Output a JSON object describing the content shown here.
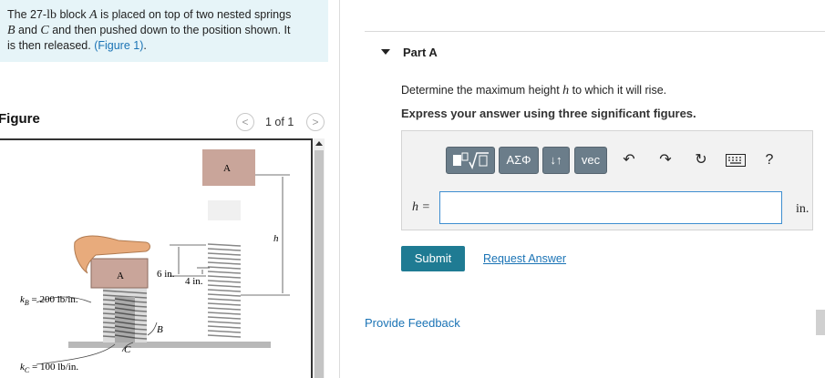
{
  "problem": {
    "line1_pre": "The 27-",
    "line1_unit": "lb",
    "line1_mid": " block ",
    "line1_A": "A",
    "line1_post": " is placed on top of two nested springs",
    "line2_B": "B",
    "line2_mid": " and ",
    "line2_C": "C",
    "line2_post": " and then pushed down to the position shown. It",
    "line3_pre": "is then released. ",
    "figure_link": "(Figure 1)",
    "line3_post": "."
  },
  "figure": {
    "title": "Figure",
    "pager_text": "1 of 1",
    "prev_icon": "chevron-left",
    "next_icon": "chevron-right",
    "labels": {
      "block_top": "A",
      "block_bottom": "A",
      "h": "h",
      "six_in": "6 in.",
      "four_in": "4 in.",
      "kB": "k",
      "kB_sub": "B",
      "kB_val": " = 200 lb/in.",
      "kC": "k",
      "kC_sub": "C",
      "kC_val": " = 100 lb/in.",
      "B": "B",
      "C": "C"
    }
  },
  "part": {
    "label": "Part A",
    "question_pre": "Determine the maximum height ",
    "question_var": "h",
    "question_post": " to which it will rise.",
    "instruction": "Express your answer using three significant figures."
  },
  "toolbar": {
    "templates_icon": "templates-sqrt-icon",
    "greek_label": "ΑΣΦ",
    "updown_label": "↓↑",
    "vec_label": "vec",
    "undo_icon": "undo-arrow",
    "redo_icon": "redo-arrow",
    "reset_icon": "reset-circle-arrow",
    "keyboard_icon": "keyboard",
    "help_label": "?"
  },
  "answer": {
    "label": "h =",
    "value": "",
    "unit": "in."
  },
  "buttons": {
    "submit": "Submit",
    "request": "Request Answer",
    "feedback": "Provide Feedback"
  },
  "colors": {
    "problem_bg": "#e6f4f8",
    "link": "#1a73b5",
    "submit_bg": "#1f7b93",
    "toolbar_btn": "#6b7d8a",
    "block": "#c9a59a"
  }
}
